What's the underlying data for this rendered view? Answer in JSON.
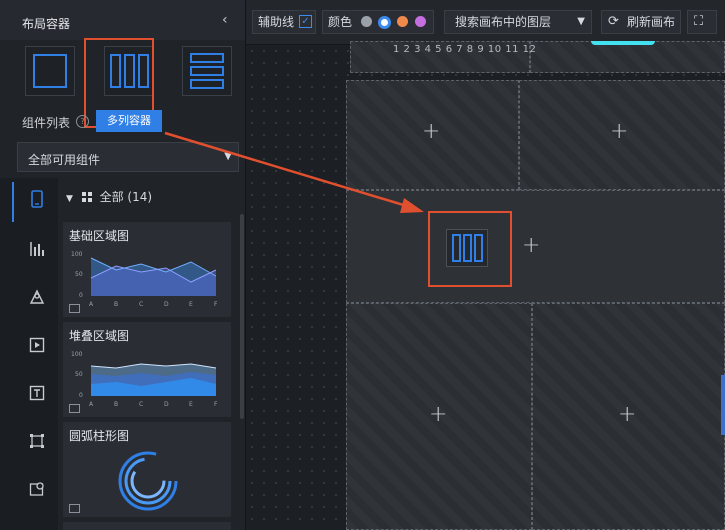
{
  "left_panel": {
    "title": "布局容器",
    "collapse_icon": "chevron-left-icon",
    "tooltip": "多列容器",
    "components_label": "组件列表",
    "filter": {
      "value": "全部可用组件"
    },
    "tree": {
      "label": "全部 (14)"
    },
    "cards": [
      {
        "title": "基础区域图",
        "axis_y": [
          "100",
          "50",
          "0"
        ],
        "axis_x": [
          "A",
          "B",
          "C",
          "D",
          "E",
          "F"
        ]
      },
      {
        "title": "堆叠区域图",
        "axis_y": [
          "100",
          "50",
          "0"
        ],
        "axis_x": [
          "A",
          "B",
          "C",
          "D",
          "E",
          "F"
        ]
      },
      {
        "title": "圆弧柱形图"
      }
    ]
  },
  "toolbar": {
    "guides_label": "辅助线",
    "color_label": "颜色",
    "layer_search": {
      "placeholder": "搜索画布中的图层"
    },
    "refresh_label": "刷新画布",
    "colors": [
      "#9aa1a9",
      "#3b8bf0",
      "#ef8a4c",
      "#c46ee0"
    ]
  },
  "canvas": {
    "ruler_text": "1 2 3 4 5 6 7 8 9 10 11 12"
  },
  "colors": {
    "accent": "#2f7fe6",
    "highlight": "#e0502f"
  }
}
